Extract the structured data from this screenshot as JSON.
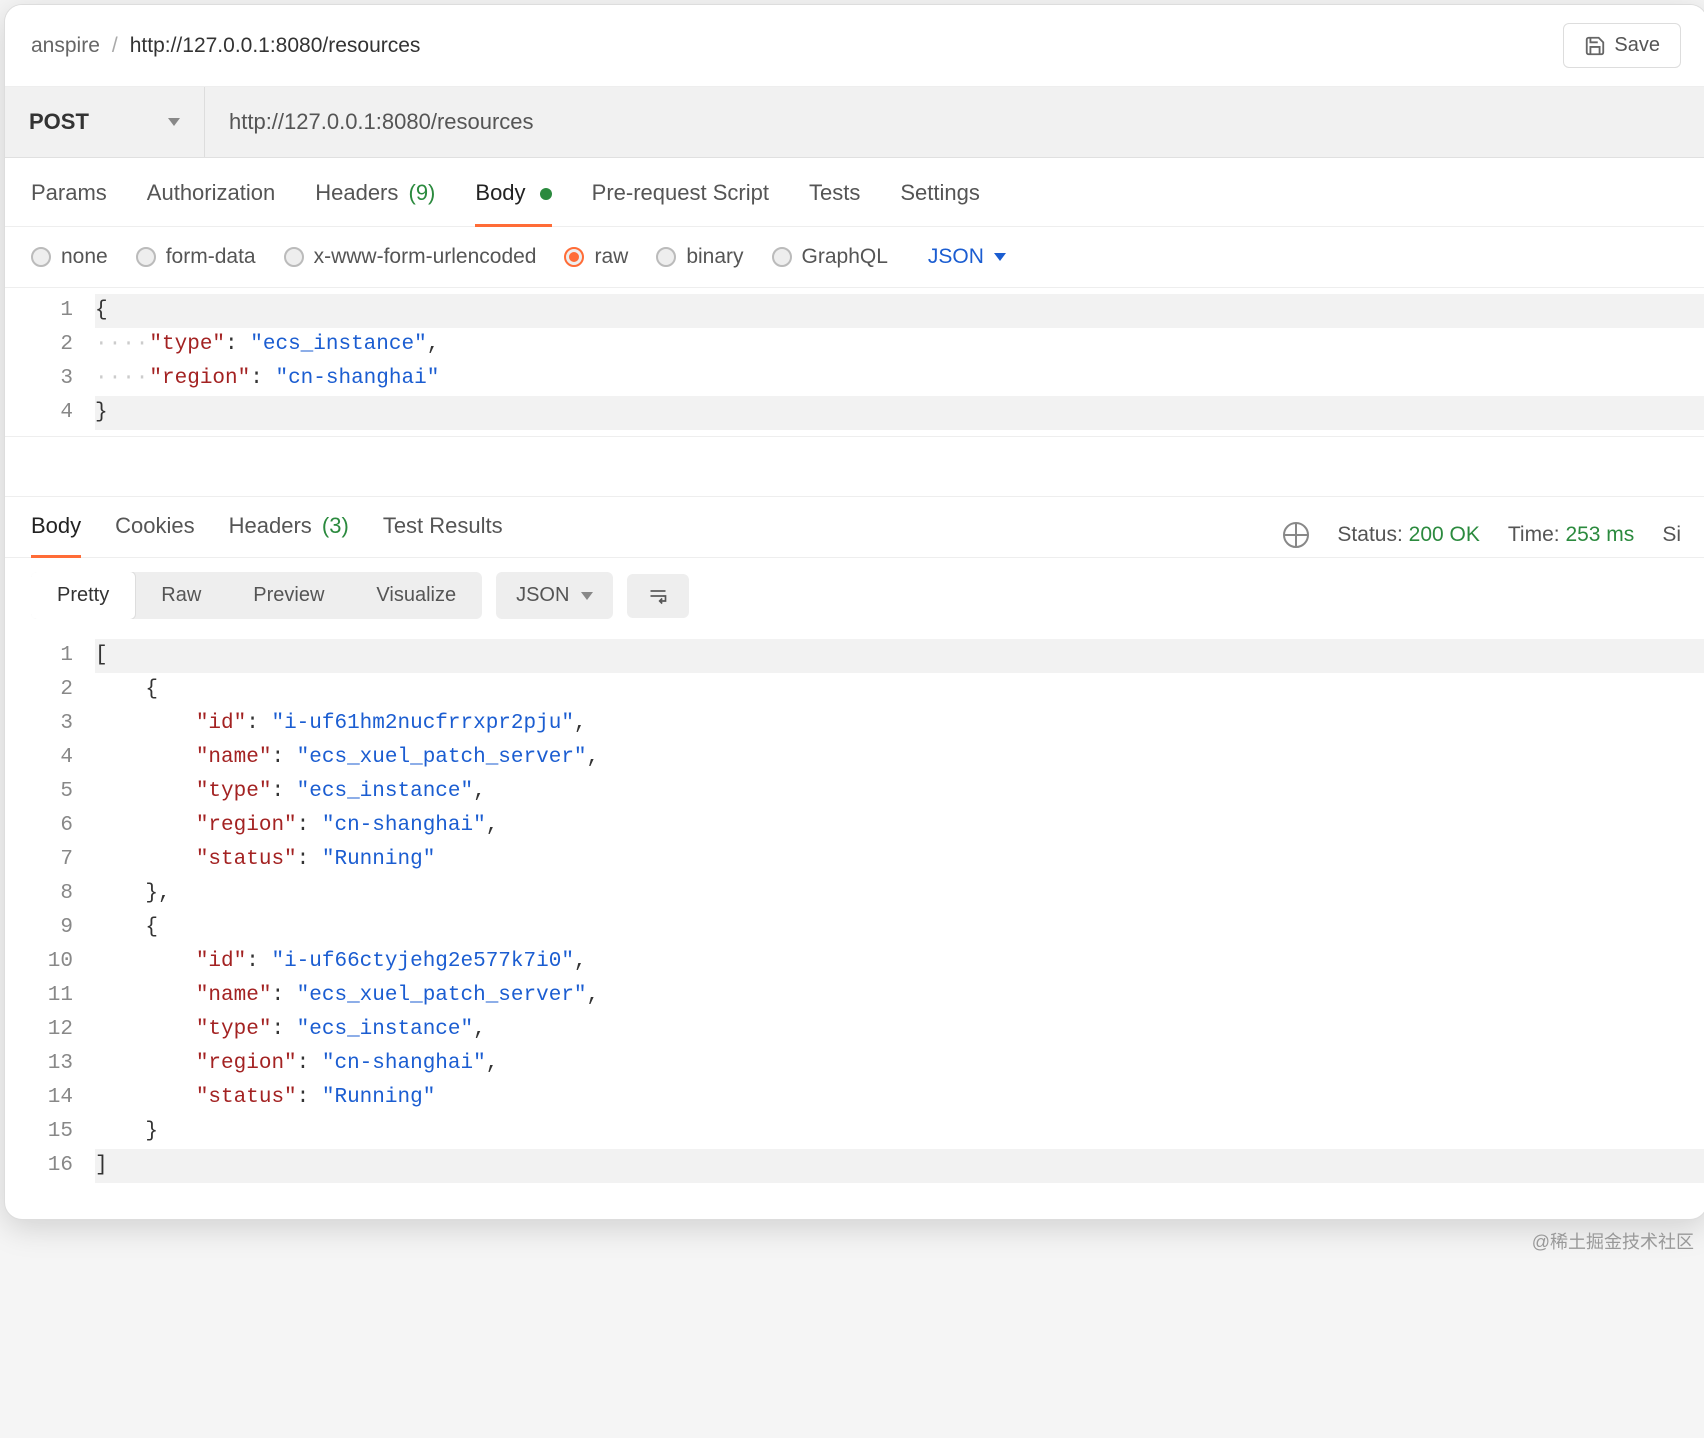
{
  "breadcrumb": {
    "workspace": "anspire",
    "title": "http://127.0.0.1:8080/resources"
  },
  "save_label": "Save",
  "request": {
    "method": "POST",
    "url": "http://127.0.0.1:8080/resources"
  },
  "req_tabs": {
    "params": "Params",
    "auth": "Authorization",
    "headers_label": "Headers",
    "headers_count": "(9)",
    "body": "Body",
    "pre": "Pre-request Script",
    "tests": "Tests",
    "settings": "Settings"
  },
  "body_types": {
    "none": "none",
    "form": "form-data",
    "xform": "x-www-form-urlencoded",
    "raw": "raw",
    "binary": "binary",
    "graphql": "GraphQL",
    "format": "JSON"
  },
  "request_body": {
    "lines": [
      "1",
      "2",
      "3",
      "4"
    ],
    "tokens": [
      [
        {
          "t": "{",
          "c": "punc"
        }
      ],
      [
        {
          "t": "····",
          "c": "indent-dots"
        },
        {
          "t": "\"type\"",
          "c": "key"
        },
        {
          "t": ": ",
          "c": "punc"
        },
        {
          "t": "\"ecs_instance\"",
          "c": "str"
        },
        {
          "t": ",",
          "c": "punc"
        }
      ],
      [
        {
          "t": "····",
          "c": "indent-dots"
        },
        {
          "t": "\"region\"",
          "c": "key"
        },
        {
          "t": ": ",
          "c": "punc"
        },
        {
          "t": "\"cn-shanghai\"",
          "c": "str"
        }
      ],
      [
        {
          "t": "}",
          "c": "punc"
        }
      ]
    ]
  },
  "resp_tabs": {
    "body": "Body",
    "cookies": "Cookies",
    "headers_label": "Headers",
    "headers_count": "(3)",
    "test": "Test Results"
  },
  "resp_status": {
    "status_label": "Status:",
    "status_value": "200 OK",
    "time_label": "Time:",
    "time_value": "253 ms",
    "size_label": "Si"
  },
  "view_modes": {
    "pretty": "Pretty",
    "raw": "Raw",
    "preview": "Preview",
    "visualize": "Visualize",
    "format": "JSON"
  },
  "response_body": {
    "lines": [
      "1",
      "2",
      "3",
      "4",
      "5",
      "6",
      "7",
      "8",
      "9",
      "10",
      "11",
      "12",
      "13",
      "14",
      "15",
      "16"
    ],
    "tokens": [
      [
        {
          "t": "[",
          "c": "punc"
        }
      ],
      [
        {
          "t": "    {",
          "c": "punc"
        }
      ],
      [
        {
          "t": "        ",
          "c": "punc"
        },
        {
          "t": "\"id\"",
          "c": "key"
        },
        {
          "t": ": ",
          "c": "punc"
        },
        {
          "t": "\"i-uf61hm2nucfrrxpr2pju\"",
          "c": "str"
        },
        {
          "t": ",",
          "c": "punc"
        }
      ],
      [
        {
          "t": "        ",
          "c": "punc"
        },
        {
          "t": "\"name\"",
          "c": "key"
        },
        {
          "t": ": ",
          "c": "punc"
        },
        {
          "t": "\"ecs_xuel_patch_server\"",
          "c": "str"
        },
        {
          "t": ",",
          "c": "punc"
        }
      ],
      [
        {
          "t": "        ",
          "c": "punc"
        },
        {
          "t": "\"type\"",
          "c": "key"
        },
        {
          "t": ": ",
          "c": "punc"
        },
        {
          "t": "\"ecs_instance\"",
          "c": "str"
        },
        {
          "t": ",",
          "c": "punc"
        }
      ],
      [
        {
          "t": "        ",
          "c": "punc"
        },
        {
          "t": "\"region\"",
          "c": "key"
        },
        {
          "t": ": ",
          "c": "punc"
        },
        {
          "t": "\"cn-shanghai\"",
          "c": "str"
        },
        {
          "t": ",",
          "c": "punc"
        }
      ],
      [
        {
          "t": "        ",
          "c": "punc"
        },
        {
          "t": "\"status\"",
          "c": "key"
        },
        {
          "t": ": ",
          "c": "punc"
        },
        {
          "t": "\"Running\"",
          "c": "str"
        }
      ],
      [
        {
          "t": "    },",
          "c": "punc"
        }
      ],
      [
        {
          "t": "    {",
          "c": "punc"
        }
      ],
      [
        {
          "t": "        ",
          "c": "punc"
        },
        {
          "t": "\"id\"",
          "c": "key"
        },
        {
          "t": ": ",
          "c": "punc"
        },
        {
          "t": "\"i-uf66ctyjehg2e577k7i0\"",
          "c": "str"
        },
        {
          "t": ",",
          "c": "punc"
        }
      ],
      [
        {
          "t": "        ",
          "c": "punc"
        },
        {
          "t": "\"name\"",
          "c": "key"
        },
        {
          "t": ": ",
          "c": "punc"
        },
        {
          "t": "\"ecs_xuel_patch_server\"",
          "c": "str"
        },
        {
          "t": ",",
          "c": "punc"
        }
      ],
      [
        {
          "t": "        ",
          "c": "punc"
        },
        {
          "t": "\"type\"",
          "c": "key"
        },
        {
          "t": ": ",
          "c": "punc"
        },
        {
          "t": "\"ecs_instance\"",
          "c": "str"
        },
        {
          "t": ",",
          "c": "punc"
        }
      ],
      [
        {
          "t": "        ",
          "c": "punc"
        },
        {
          "t": "\"region\"",
          "c": "key"
        },
        {
          "t": ": ",
          "c": "punc"
        },
        {
          "t": "\"cn-shanghai\"",
          "c": "str"
        },
        {
          "t": ",",
          "c": "punc"
        }
      ],
      [
        {
          "t": "        ",
          "c": "punc"
        },
        {
          "t": "\"status\"",
          "c": "key"
        },
        {
          "t": ": ",
          "c": "punc"
        },
        {
          "t": "\"Running\"",
          "c": "str"
        }
      ],
      [
        {
          "t": "    }",
          "c": "punc"
        }
      ],
      [
        {
          "t": "]",
          "c": "punc"
        }
      ]
    ]
  },
  "watermark": "@稀土掘金技术社区"
}
